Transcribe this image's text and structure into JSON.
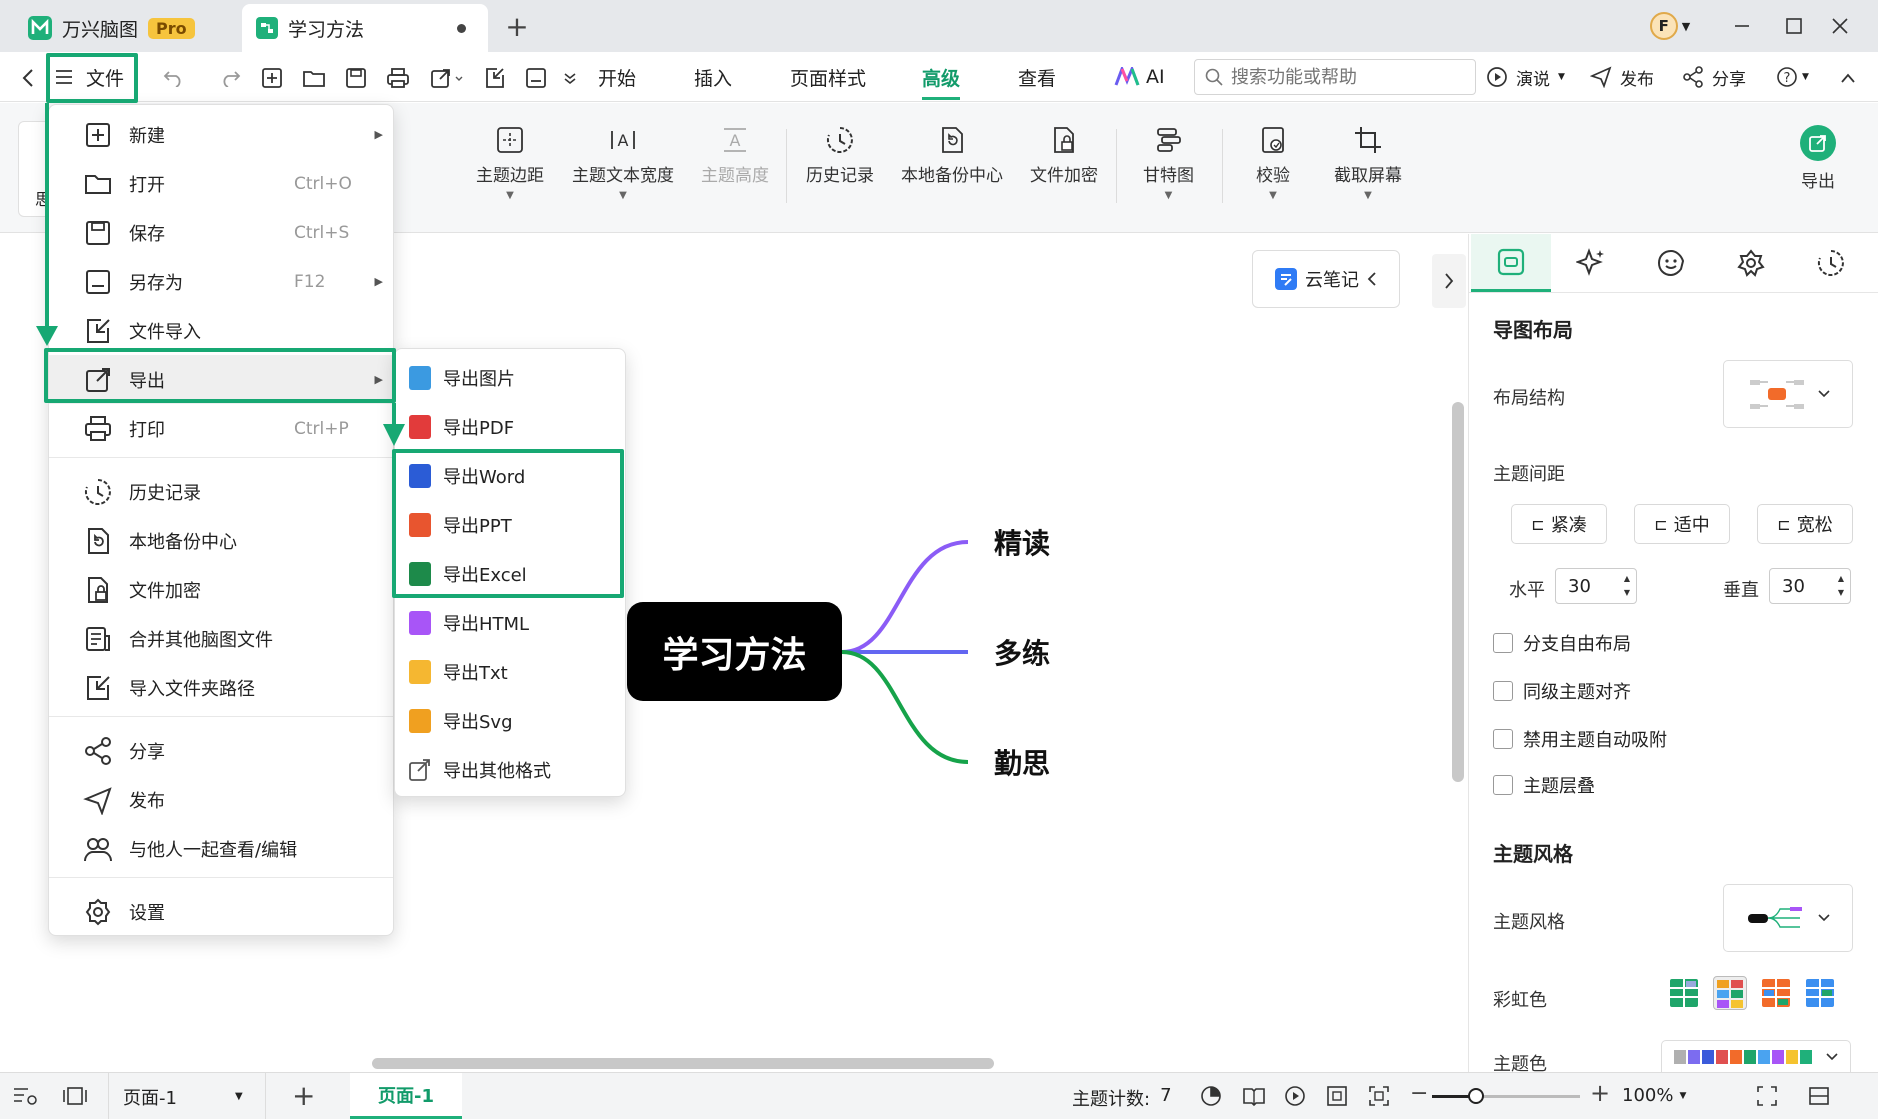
{
  "titlebar": {
    "app_name": "万兴脑图",
    "pro_badge": "Pro",
    "doc_tab": "学习方法",
    "new_tab": "+",
    "avatar_letter": "F"
  },
  "menubar": {
    "file_label": "文件",
    "tabs": [
      "开始",
      "插入",
      "页面样式",
      "高级",
      "查看"
    ],
    "active_tab": "高级",
    "ai_label": "AI",
    "search_placeholder": "搜索功能或帮助",
    "present_label": "演说",
    "publish_label": "发布",
    "share_label": "分享"
  },
  "ribbon": {
    "buttons": [
      "主题边距",
      "主题文本宽度",
      "主题高度",
      "历史记录",
      "本地备份中心",
      "文件加密",
      "甘特图",
      "校验",
      "截取屏幕"
    ],
    "left_stub": "思",
    "export_label": "导出"
  },
  "canvas": {
    "central_topic": "学习方法",
    "branches": [
      "精读",
      "多练",
      "勤思"
    ],
    "cloud_note": "云笔记",
    "branch_colors": [
      "#8b5cf6",
      "#6366f1",
      "#16a34a"
    ]
  },
  "file_menu": {
    "items": [
      {
        "label": "新建",
        "shortcut": "",
        "submenu": true
      },
      {
        "label": "打开",
        "shortcut": "Ctrl+O",
        "submenu": false
      },
      {
        "label": "保存",
        "shortcut": "Ctrl+S",
        "submenu": false
      },
      {
        "label": "另存为",
        "shortcut": "F12",
        "submenu": true
      },
      {
        "label": "文件导入",
        "shortcut": "",
        "submenu": false
      },
      {
        "label": "导出",
        "shortcut": "",
        "submenu": true
      },
      {
        "label": "打印",
        "shortcut": "Ctrl+P",
        "submenu": false
      }
    ],
    "group2": [
      "历史记录",
      "本地备份中心",
      "文件加密",
      "合并其他脑图文件",
      "导入文件夹路径"
    ],
    "group3": [
      "分享",
      "发布",
      "与他人一起查看/编辑"
    ],
    "settings": "设置"
  },
  "export_menu": {
    "items": [
      {
        "label": "导出图片",
        "color": "#3b9ae1"
      },
      {
        "label": "导出PDF",
        "color": "#e23b3b"
      },
      {
        "label": "导出Word",
        "color": "#2b5cd6"
      },
      {
        "label": "导出PPT",
        "color": "#e8552f"
      },
      {
        "label": "导出Excel",
        "color": "#1d8a4a"
      },
      {
        "label": "导出HTML",
        "color": "#a855f7"
      },
      {
        "label": "导出Txt",
        "color": "#f5b731"
      },
      {
        "label": "导出Svg",
        "color": "#f0a020"
      },
      {
        "label": "导出其他格式",
        "color": "#555555"
      }
    ]
  },
  "right_panel": {
    "section_layout": "导图布局",
    "layout_structure": "布局结构",
    "topic_spacing": "主题间距",
    "spacing_options": [
      "紧凑",
      "适中",
      "宽松"
    ],
    "horizontal_label": "水平",
    "horizontal_value": "30",
    "vertical_label": "垂直",
    "vertical_value": "30",
    "checkboxes": [
      "分支自由布局",
      "同级主题对齐",
      "禁用主题自动吸附",
      "主题层叠"
    ],
    "section_style": "主题风格",
    "topic_style": "主题风格",
    "rainbow": "彩虹色",
    "theme_color": "主题色"
  },
  "statusbar": {
    "page_select": "页面-1",
    "page_tab": "页面-1",
    "topic_count_label": "主题计数:",
    "topic_count": "7",
    "zoom": "100%",
    "zoom_fraction": 0.3
  },
  "accent": "#17a873"
}
